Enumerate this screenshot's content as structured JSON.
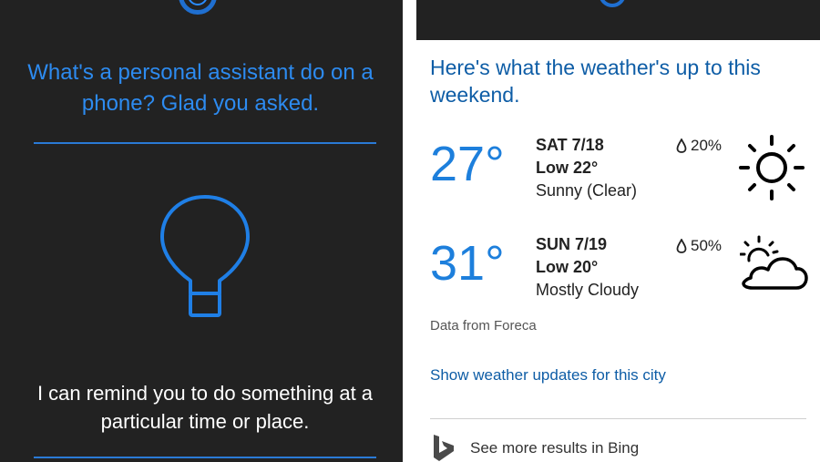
{
  "left_panel": {
    "heading": "What's a personal assistant do on a phone? Glad you asked.",
    "body": "I can remind you to do something at a particular time or place.",
    "accent": "#2d8bf0",
    "icons": [
      "cortana-icon",
      "lightbulb-icon"
    ]
  },
  "right_panel": {
    "heading": "Here's what the weather's up to this weekend.",
    "forecast": [
      {
        "temp": "27°",
        "day": "SAT 7/18",
        "low": "Low 22°",
        "condition": "Sunny (Clear)",
        "precip": "20%",
        "icon": "sun-icon"
      },
      {
        "temp": "31°",
        "day": "SUN 7/19",
        "low": "Low 20°",
        "condition": "Mostly Cloudy",
        "precip": "50%",
        "icon": "partly-cloudy-icon"
      }
    ],
    "source": "Data from Foreca",
    "link": "Show weather updates for this city",
    "bing": "See more results in Bing",
    "accent": "#1d7fdc",
    "link_color": "#0e5da6"
  }
}
